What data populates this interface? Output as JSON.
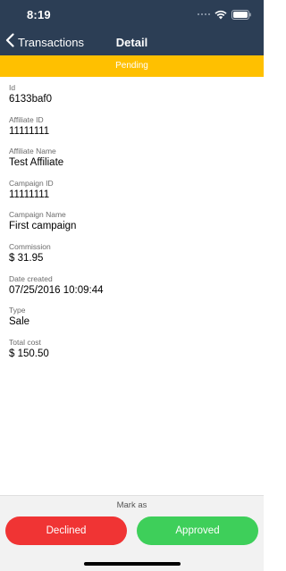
{
  "status_bar": {
    "time": "8:19"
  },
  "nav": {
    "back_label": "Transactions",
    "title": "Detail"
  },
  "status_banner": {
    "text": "Pending",
    "color": "#ffc000"
  },
  "fields": [
    {
      "label": "Id",
      "value": "6133baf0"
    },
    {
      "label": "Affiliate ID",
      "value": "11111111"
    },
    {
      "label": "Affiliate Name",
      "value": "Test Affiliate"
    },
    {
      "label": "Campaign ID",
      "value": "11111111"
    },
    {
      "label": "Campaign Name",
      "value": "First campaign"
    },
    {
      "label": "Commission",
      "value": "$ 31.95"
    },
    {
      "label": "Date created",
      "value": "07/25/2016 10:09:44"
    },
    {
      "label": "Type",
      "value": "Sale"
    },
    {
      "label": "Total cost",
      "value": "$ 150.50"
    }
  ],
  "actions": {
    "mark_as_label": "Mark as",
    "declined_label": "Declined",
    "approved_label": "Approved",
    "declined_color": "#f03434",
    "approved_color": "#3ecf5a"
  },
  "colors": {
    "nav_background": "#2c3e55"
  },
  "icons": {
    "back": "chevron-left-icon",
    "signal": "signal-icon",
    "wifi": "wifi-icon",
    "battery": "battery-icon"
  }
}
